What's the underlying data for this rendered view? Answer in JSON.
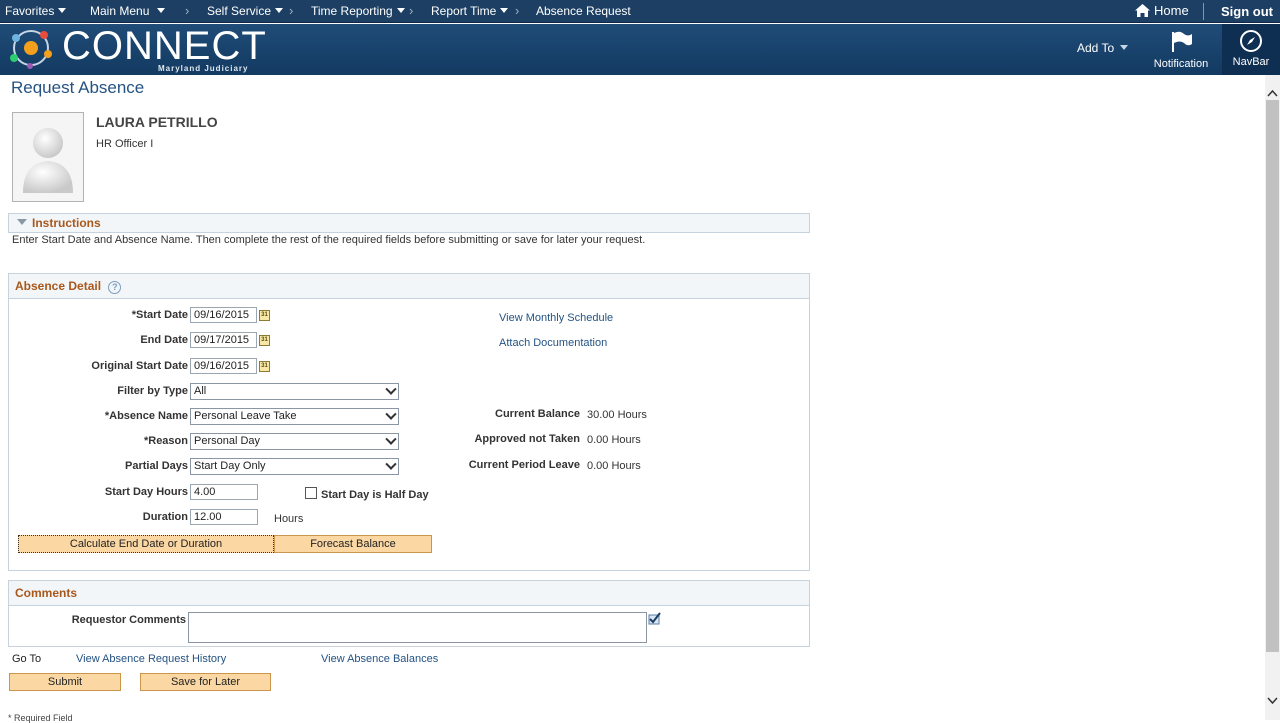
{
  "topnav": {
    "favorites": "Favorites",
    "main_menu": "Main Menu",
    "self_service": "Self Service",
    "time_reporting": "Time Reporting",
    "report_time": "Report Time",
    "current": "Absence Request",
    "home": "Home",
    "sign_out": "Sign out"
  },
  "banner": {
    "logo": "CONNECT",
    "logo_sub": "Maryland Judiciary",
    "add_to": "Add To",
    "notification": "Notification",
    "navbar": "NavBar"
  },
  "page": {
    "title": "Request Absence",
    "employee_name": "LAURA PETRILLO",
    "employee_title": "HR Officer I"
  },
  "instructions": {
    "header": "Instructions",
    "text": "Enter Start Date and Absence Name. Then complete the rest of the required fields before submitting or save for later your request."
  },
  "absence_detail": {
    "header": "Absence Detail",
    "start_date_label": "*Start Date",
    "start_date": "09/16/2015",
    "end_date_label": "End Date",
    "end_date": "09/17/2015",
    "orig_start_label": "Original Start Date",
    "orig_start": "09/16/2015",
    "filter_label": "Filter by Type",
    "filter_value": "All",
    "absence_name_label": "*Absence Name",
    "absence_name_value": "Personal Leave Take",
    "reason_label": "*Reason",
    "reason_value": "Personal Day",
    "partial_label": "Partial Days",
    "partial_value": "Start Day Only",
    "start_hours_label": "Start Day Hours",
    "start_hours": "4.00",
    "half_day_label": "Start Day is Half Day",
    "duration_label": "Duration",
    "duration": "12.00",
    "duration_unit": "Hours",
    "view_schedule": "View Monthly Schedule",
    "attach_doc": "Attach Documentation",
    "current_balance_label": "Current Balance",
    "current_balance": "30.00 Hours",
    "approved_label": "Approved not Taken",
    "approved": "0.00 Hours",
    "current_period_label": "Current Period Leave",
    "current_period": "0.00 Hours",
    "calc_button": "Calculate End Date or Duration",
    "forecast_button": "Forecast Balance"
  },
  "comments": {
    "header": "Comments",
    "requestor_label": "Requestor Comments",
    "requestor_value": ""
  },
  "goto": {
    "label": "Go To",
    "history": "View Absence Request History",
    "balances": "View Absence Balances"
  },
  "actions": {
    "submit": "Submit",
    "save": "Save for Later"
  },
  "footer": {
    "required": "* Required Field"
  }
}
